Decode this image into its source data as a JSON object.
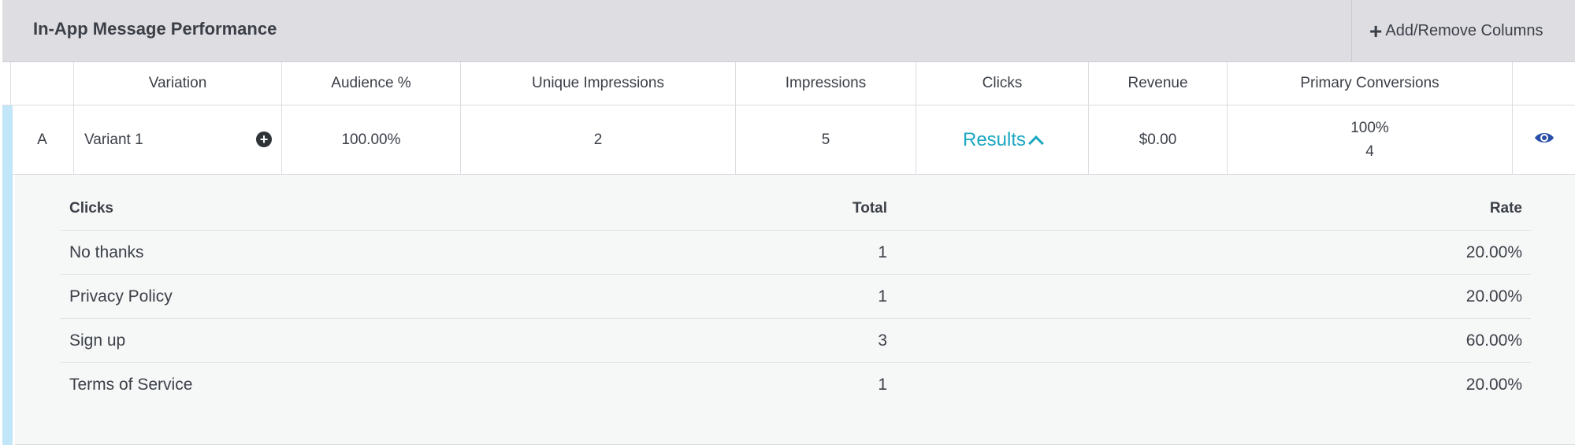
{
  "header": {
    "title": "In-App Message Performance",
    "add_columns_label": "Add/Remove Columns",
    "add_columns_icon": "+"
  },
  "columns": {
    "variation": "Variation",
    "audience": "Audience %",
    "unique_impressions": "Unique Impressions",
    "impressions": "Impressions",
    "clicks": "Clicks",
    "revenue": "Revenue",
    "primary_conversions": "Primary Conversions"
  },
  "row": {
    "letter": "A",
    "variation": "Variant 1",
    "audience": "100.00%",
    "unique_impressions": "2",
    "impressions": "5",
    "clicks_link": "Results",
    "revenue": "$0.00",
    "conversion_rate": "100%",
    "conversion_count": "4"
  },
  "clicks_breakdown": {
    "headers": {
      "name": "Clicks",
      "total": "Total",
      "rate": "Rate"
    },
    "rows": [
      {
        "name": "No thanks",
        "total": "1",
        "rate": "20.00%"
      },
      {
        "name": "Privacy Policy",
        "total": "1",
        "rate": "20.00%"
      },
      {
        "name": "Sign up",
        "total": "3",
        "rate": "60.00%"
      },
      {
        "name": "Terms of Service",
        "total": "1",
        "rate": "20.00%"
      }
    ]
  },
  "colors": {
    "accent_link": "#1aa7c1",
    "row_accent": "#c1e6f7",
    "header_bg": "#dedde2",
    "eye_icon": "#2b4fa8"
  },
  "icons": {
    "add_variant": "plus-circle-icon",
    "expand": "chevron-up-icon",
    "preview": "eye-icon"
  }
}
